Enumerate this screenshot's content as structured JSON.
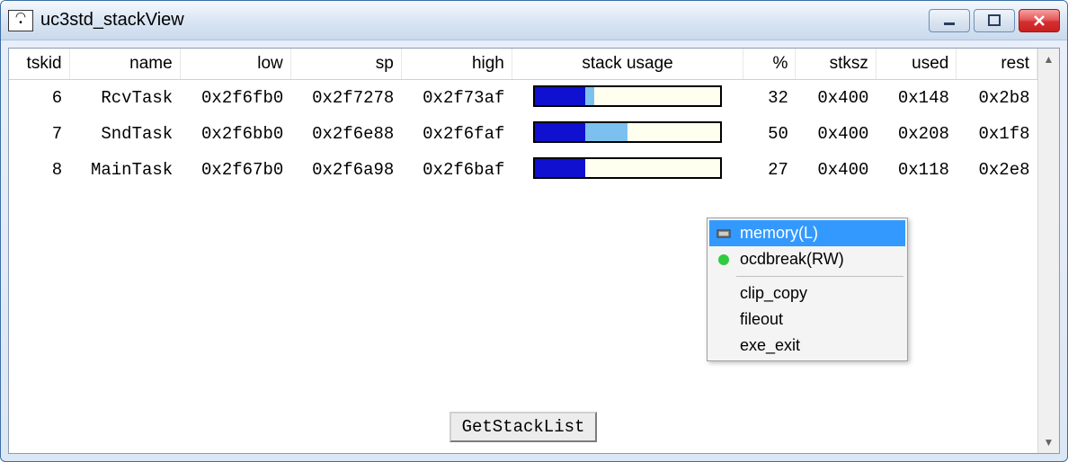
{
  "window": {
    "title": "uc3std_stackView"
  },
  "table": {
    "headers": {
      "tskid": "tskid",
      "name": "name",
      "low": "low",
      "sp": "sp",
      "high": "high",
      "usage": "stack usage",
      "pct": "%",
      "stksz": "stksz",
      "used": "used",
      "rest": "rest"
    },
    "rows": [
      {
        "tskid": "6",
        "name": "RcvTask",
        "low": "0x2f6fb0",
        "sp": "0x2f7278",
        "high": "0x2f73af",
        "solid_pct": 27,
        "light_pct": 5,
        "pct": "32",
        "stksz": "0x400",
        "used": "0x148",
        "rest": "0x2b8"
      },
      {
        "tskid": "7",
        "name": "SndTask",
        "low": "0x2f6bb0",
        "sp": "0x2f6e88",
        "high": "0x2f6faf",
        "solid_pct": 27,
        "light_pct": 23,
        "pct": "50",
        "stksz": "0x400",
        "used": "0x208",
        "rest": "0x1f8"
      },
      {
        "tskid": "8",
        "name": "MainTask",
        "low": "0x2f67b0",
        "sp": "0x2f6a98",
        "high": "0x2f6baf",
        "solid_pct": 27,
        "light_pct": 0,
        "pct": "27",
        "stksz": "0x400",
        "used": "0x118",
        "rest": "0x2e8"
      }
    ]
  },
  "button": {
    "get_stack_list": "GetStackList"
  },
  "context_menu": {
    "items": [
      {
        "label": "memory(L)",
        "icon": "chip",
        "highlight": true
      },
      {
        "label": "ocdbreak(RW)",
        "icon": "greendot",
        "highlight": false
      }
    ],
    "items2": [
      {
        "label": "clip_copy"
      },
      {
        "label": "fileout"
      },
      {
        "label": "exe_exit"
      }
    ]
  }
}
